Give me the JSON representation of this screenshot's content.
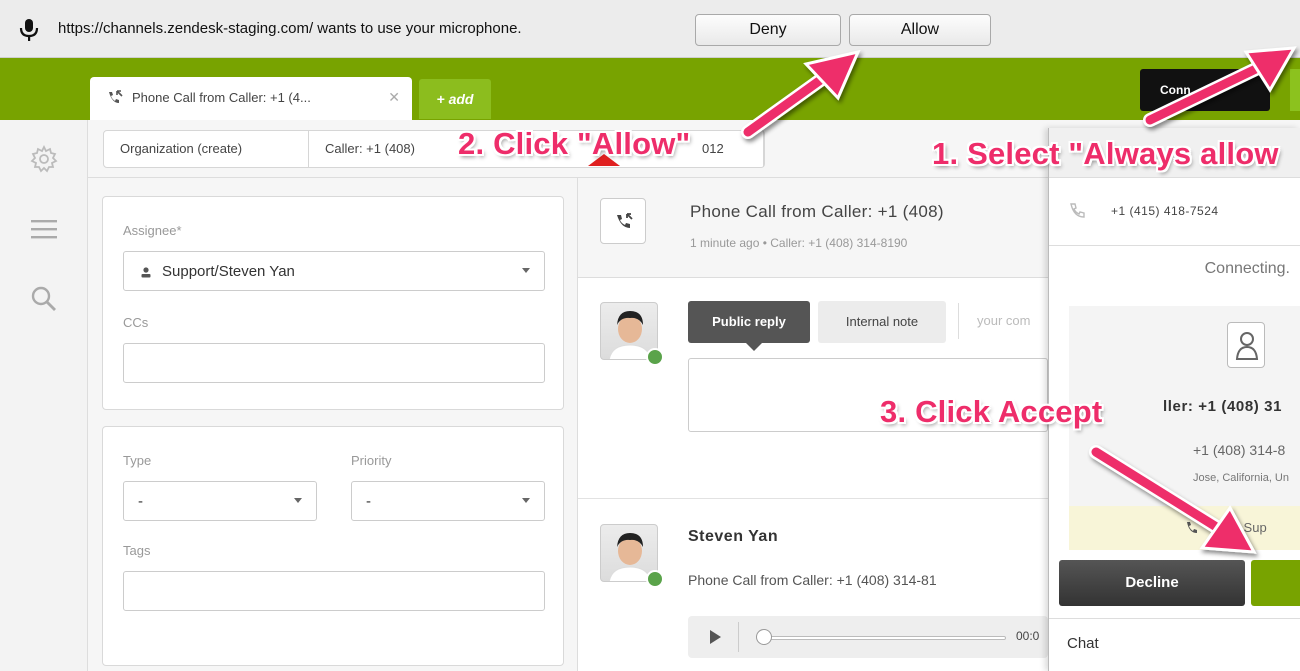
{
  "permission_bar": {
    "message": "https://channels.zendesk-staging.com/ wants to use your microphone.",
    "deny_label": "Deny",
    "allow_label": "Allow",
    "icon": "microphone-icon"
  },
  "nav": {
    "active_tab_label": "Phone Call from Caller: +1 (4...",
    "add_tab_label": "+ add",
    "connect_label": "Conn",
    "colors": {
      "brand_green": "#78a300",
      "annotation_pink": "#ee2d6a"
    }
  },
  "sidebar": {
    "icons": [
      "settings-icon",
      "menu-icon",
      "search-icon"
    ]
  },
  "breadcrumb": {
    "organization": "Organization (create)",
    "caller": "Caller: +1 (408)",
    "tail": "012"
  },
  "properties": {
    "assignee_label": "Assignee*",
    "assignee_value": "Support/Steven Yan",
    "ccs_label": "CCs",
    "type_label": "Type",
    "type_value": "-",
    "priority_label": "Priority",
    "priority_value": "-",
    "tags_label": "Tags"
  },
  "conversation": {
    "title": "Phone Call from Caller: +1 (408)",
    "meta": "1 minute ago  •  Caller: +1 (408) 314-8190",
    "public_reply": "Public reply",
    "internal_note": "Internal note",
    "reply_hint": "your com",
    "author": "Steven Yan",
    "snippet": "Phone Call from Caller: +1 (408) 314-81",
    "player_time": "00:0"
  },
  "voice_panel": {
    "line_number": "+1 (415) 418-7524",
    "status": "Connecting.",
    "caller_name": "ller: +1 (408) 31",
    "caller_number": "+1 (408) 314-8",
    "caller_location": "Jose, California, Un",
    "support_text": "ium Sup",
    "decline_label": "Decline",
    "chat_label": "Chat"
  },
  "annotations": {
    "step1": "1. Select \"Always allow",
    "step2": "2. Click \"Allow\"",
    "step3": "3. Click Accept"
  }
}
